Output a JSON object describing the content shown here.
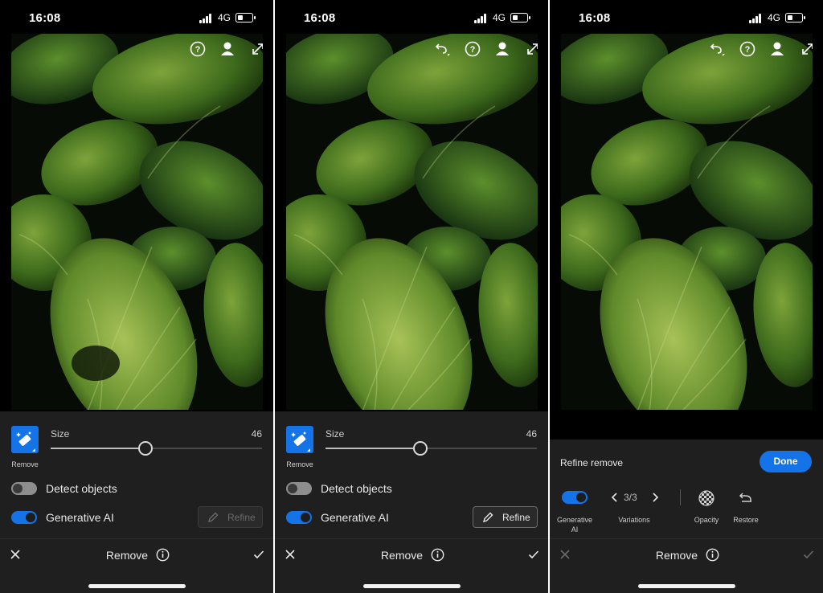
{
  "status": {
    "time": "16:08",
    "network": "4G"
  },
  "screens": [
    {
      "size_label": "Size",
      "size_value": "46",
      "size_level": 0.45,
      "tool_label": "Remove",
      "detect_label": "Detect objects",
      "detect_on": false,
      "gen_ai_label": "Generative AI",
      "gen_ai_on": true,
      "refine_label": "Refine",
      "refine_enabled": false,
      "title": "Remove"
    },
    {
      "size_label": "Size",
      "size_value": "46",
      "size_level": 0.45,
      "tool_label": "Remove",
      "detect_label": "Detect objects",
      "detect_on": false,
      "gen_ai_label": "Generative AI",
      "gen_ai_on": true,
      "refine_label": "Refine",
      "refine_enabled": true,
      "title": "Remove"
    },
    {
      "refine_title": "Refine remove",
      "done_label": "Done",
      "gen_ai_label_1": "Generative",
      "gen_ai_label_2": "AI",
      "variation_count": "3/3",
      "variations_label": "Variations",
      "opacity_label": "Opacity",
      "restore_label": "Restore",
      "title": "Remove"
    }
  ],
  "colors": {
    "accent": "#1473e6",
    "panel": "#1f1f1f",
    "background": "#000000"
  },
  "icons": [
    "undo-icon",
    "help-icon",
    "profile-icon",
    "expand-icon",
    "remove-tool-icon",
    "pencil-icon",
    "close-icon",
    "info-icon",
    "check-icon",
    "chevron-left-icon",
    "chevron-right-icon",
    "opacity-icon",
    "restore-icon"
  ]
}
